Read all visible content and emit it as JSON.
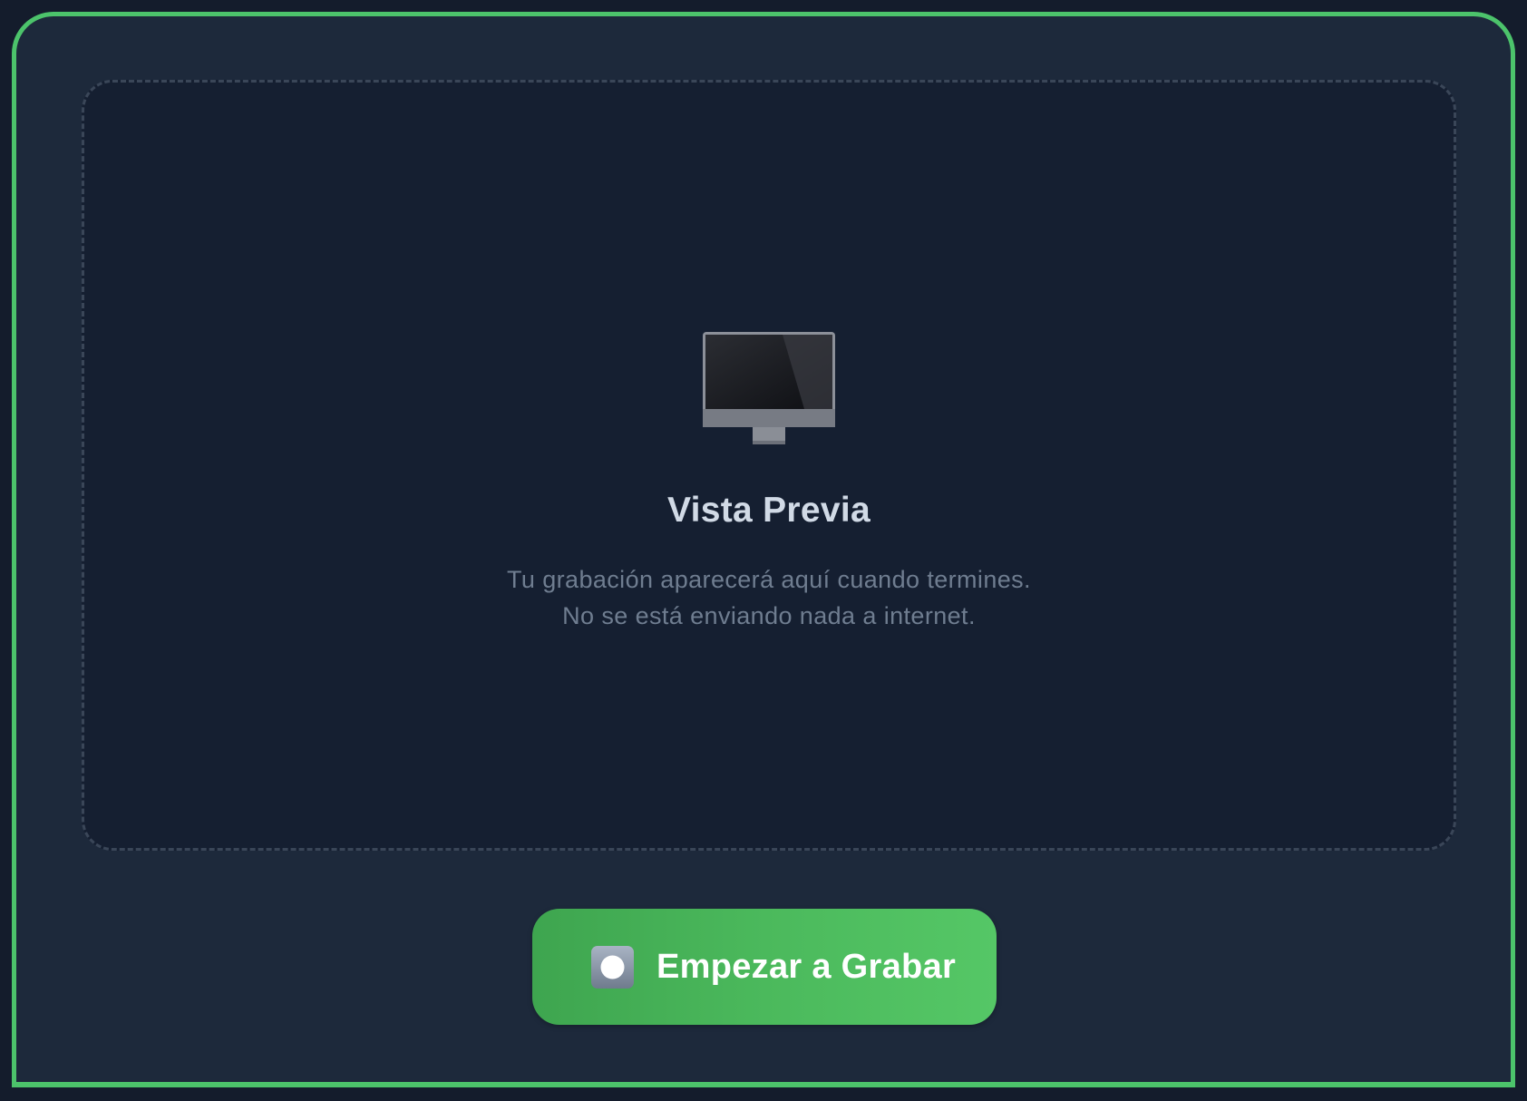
{
  "preview": {
    "icon": "desktop-computer-icon",
    "title": "Vista Previa",
    "description_line1": "Tu grabación aparecerá aquí cuando termines.",
    "description_line2": "No se está enviando nada a internet."
  },
  "record_button": {
    "icon": "record-button-icon",
    "label": "Empezar a Grabar"
  },
  "colors": {
    "accent": "#4cc36b",
    "panel_background": "#1d293b",
    "preview_background": "#151f31"
  }
}
